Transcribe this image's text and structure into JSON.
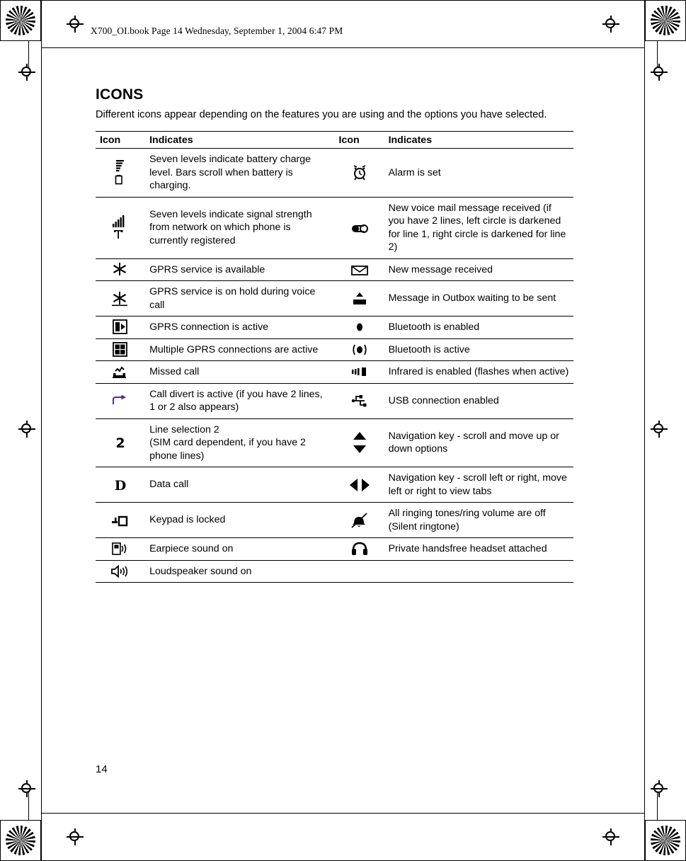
{
  "header": {
    "running_head": "X700_OI.book  Page 14  Wednesday, September 1, 2004  6:47 PM"
  },
  "page": {
    "title": "ICONS",
    "intro": "Different icons appear depending on the features you are using and the options you have selected.",
    "page_number": "14"
  },
  "table": {
    "headers": {
      "icon_left": "Icon",
      "indicates_left": "Indicates",
      "icon_right": "Icon",
      "indicates_right": "Indicates"
    },
    "rows": [
      {
        "left_icon": "battery-level-icon",
        "left_text": "Seven levels indicate battery charge level. Bars scroll when battery is charging.",
        "right_icon": "alarm-clock-icon",
        "right_text": "Alarm is set"
      },
      {
        "left_icon": "signal-strength-icon",
        "left_text": "Seven levels indicate signal strength from network on which phone is currently registered",
        "right_icon": "voicemail-icon",
        "right_text": "New voice mail message received (if you have 2 lines, left circle is darkened for line 1, right circle is darkened for line 2)"
      },
      {
        "left_icon": "gprs-available-icon",
        "left_text": "GPRS service is available",
        "right_icon": "new-message-envelope-icon",
        "right_text": "New message received"
      },
      {
        "left_icon": "gprs-on-hold-icon",
        "left_text": "GPRS service is on hold during voice call",
        "right_icon": "outbox-message-icon",
        "right_text": "Message in Outbox waiting to be sent"
      },
      {
        "left_icon": "gprs-active-icon",
        "left_text": "GPRS connection is active",
        "right_icon": "bluetooth-enabled-icon",
        "right_text": "Bluetooth is enabled"
      },
      {
        "left_icon": "multiple-gprs-icon",
        "left_text": "Multiple GPRS connections are active",
        "right_icon": "bluetooth-active-icon",
        "right_text": "Bluetooth is active"
      },
      {
        "left_icon": "missed-call-icon",
        "left_text": "Missed call",
        "right_icon": "infrared-icon",
        "right_text": "Infrared is enabled (flashes when active)"
      },
      {
        "left_icon": "call-divert-icon",
        "left_text": "Call divert is active (if you have 2 lines, 1 or 2 also appears)",
        "right_icon": "usb-connection-icon",
        "right_text": "USB connection enabled"
      },
      {
        "left_icon": "line-selection-2-icon",
        "left_text": "Line selection 2\n(SIM card dependent, if you have 2 phone lines)",
        "right_icon": "navigation-up-down-icon",
        "right_text": "Navigation key - scroll and move up or down options"
      },
      {
        "left_icon": "data-call-icon",
        "left_text": "Data call",
        "right_icon": "navigation-left-right-icon",
        "right_text": "Navigation key - scroll left or right, move left or right to view tabs"
      },
      {
        "left_icon": "keypad-locked-icon",
        "left_text": "Keypad is locked",
        "right_icon": "silent-ringtone-icon",
        "right_text": "All ringing tones/ring volume are off (Silent ringtone)"
      },
      {
        "left_icon": "earpiece-sound-icon",
        "left_text": "Earpiece sound on",
        "right_icon": "headset-icon",
        "right_text": "Private handsfree headset attached"
      },
      {
        "left_icon": "loudspeaker-icon",
        "left_text": "Loudspeaker sound on",
        "right_icon": "",
        "right_text": ""
      }
    ]
  }
}
